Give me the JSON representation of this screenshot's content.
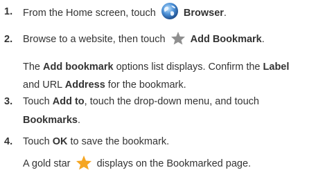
{
  "steps": [
    {
      "num": "1.",
      "text_a": "From the Home screen, touch",
      "icon": "browser-globe-icon",
      "bold_b": "Browser",
      "text_c": "."
    },
    {
      "num": "2.",
      "text_a": "Browse to a website, then touch",
      "icon": "star-icon",
      "bold_b": "Add Bookmark",
      "text_c": ".",
      "note": {
        "l1_a": "The",
        "l1_b": "Add bookmark",
        "l1_c": "options list displays. Confirm the",
        "l1_d": "Label",
        "l2_a": "and URL",
        "l2_b": "Address",
        "l2_c": "for the bookmark."
      }
    },
    {
      "num": "3.",
      "l1_a": "Touch",
      "l1_b": "Add to",
      "l1_c": ", touch the drop-down menu, and touch",
      "l2_b": "Bookmarks",
      "l2_c": "."
    },
    {
      "num": "4.",
      "text_a": "Touch",
      "bold_b": "OK",
      "text_c": "to save the bookmark.",
      "note": {
        "a": "A gold star",
        "icon": "gold-star-icon",
        "b": "displays on the Bookmarked page."
      }
    }
  ],
  "colors": {
    "text": "#333333",
    "star_gray": "#8f8f8f",
    "star_gold": "#f5a623",
    "globe_blue": "#3b7fc4"
  }
}
